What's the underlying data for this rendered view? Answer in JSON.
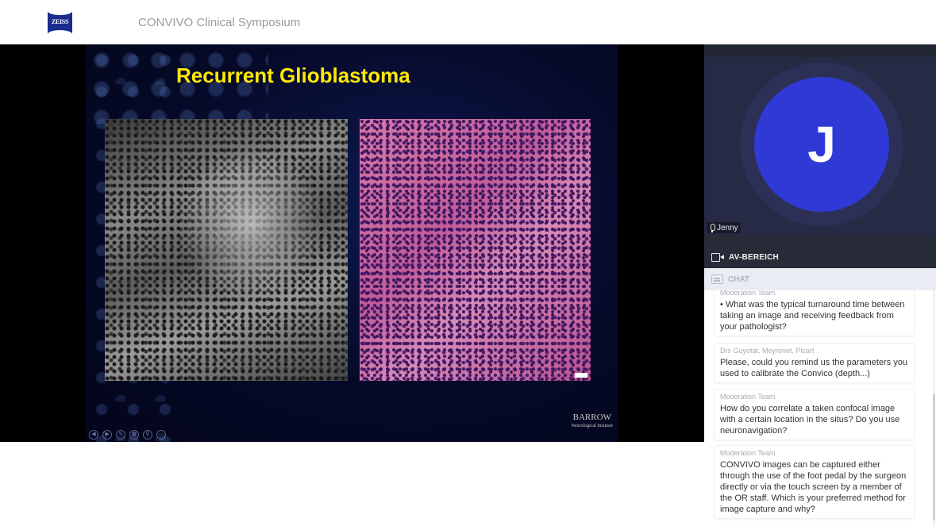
{
  "header": {
    "logo_text": "ZEISS",
    "event_title": "CONVIVO Clinical Symposium"
  },
  "slide": {
    "title": "Recurrent Glioblastoma",
    "logo_text": "BARROW",
    "logo_subtext": "Neurological Institute"
  },
  "participant": {
    "initial": "J",
    "name": "Jenny"
  },
  "av_section": {
    "label": "AV-BEREICH"
  },
  "chat": {
    "label": "CHAT",
    "messages": [
      {
        "author": "Moderation Team",
        "text": "• What was the typical turnaround time between taking an image and receiving feedback from your pathologist?"
      },
      {
        "author": "Drs Guyotat, Meyronet, Picart",
        "text": "Please, could you remind us the parameters you used to calibrate the Convico (depth...)"
      },
      {
        "author": "Moderation Team",
        "text": "How do you correlate a taken confocal image with a certain location in the situs? Do you use neuronavigation?"
      },
      {
        "author": "Moderation Team",
        "text": "CONVIVO images can be captured either through the use of the foot pedal by the surgeon directly or via the touch screen by a member of the OR staff. Which is your preferred method for image capture and why?"
      }
    ]
  },
  "colors": {
    "brand": "#1a2c8c",
    "slide_title": "#ffea00",
    "avatar": "#2f3ad6",
    "panel_dark": "#272b37"
  }
}
